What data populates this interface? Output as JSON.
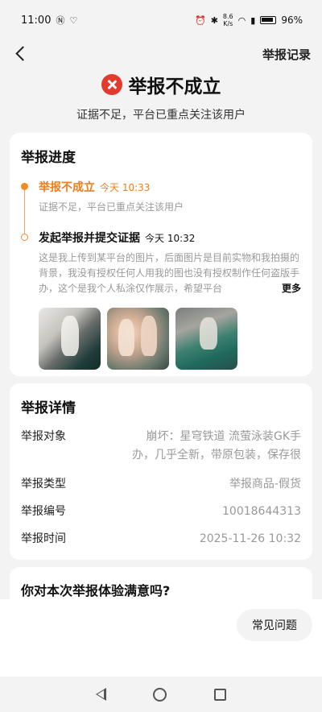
{
  "status_bar": {
    "time": "11:00",
    "net_speed_top": "8.6",
    "net_speed_bottom": "K/s",
    "battery": "96%"
  },
  "nav": {
    "records_label": "举报记录"
  },
  "result": {
    "title": "举报不成立",
    "subtitle": "证据不足，平台已重点关注该用户"
  },
  "progress": {
    "title": "举报进度",
    "steps": [
      {
        "status": "举报不成立",
        "time": "今天 10:33",
        "desc": "证据不足，平台已重点关注该用户"
      },
      {
        "status": "发起举报并提交证据",
        "time": "今天 10:32",
        "desc": "这是我上传到某平台的图片，后面图片是目前实物和我拍摄的背景，我没有授权任何人用我的图也没有授权制作任何盗版手办，这个是我个人私涂仅作展示，希望平台"
      }
    ],
    "more_label": "更多"
  },
  "details": {
    "title": "举报详情",
    "rows": [
      {
        "label": "举报对象",
        "value": "崩坏：星穹铁道 流萤泳装GK手办，几乎全新，带原包装，保存很"
      },
      {
        "label": "举报类型",
        "value": "举报商品-假货"
      },
      {
        "label": "举报编号",
        "value": "10018644313"
      },
      {
        "label": "举报时间",
        "value": "2025-11-26 10:32"
      }
    ]
  },
  "survey": {
    "title": "你对本次举报体验满意吗?"
  },
  "bottom": {
    "faq_label": "常见问题"
  }
}
